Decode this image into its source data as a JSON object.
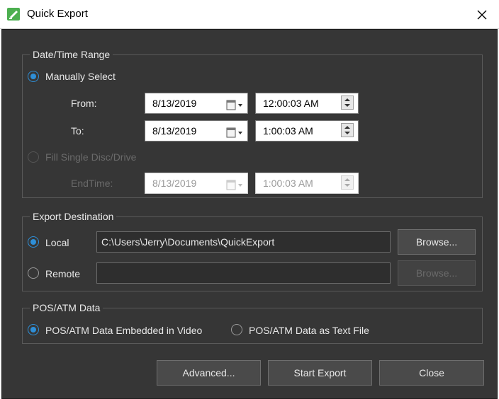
{
  "window": {
    "title": "Quick Export"
  },
  "date_range": {
    "group_title": "Date/Time Range",
    "manual_label": "Manually Select",
    "from_label": "From:",
    "from_date": "8/13/2019",
    "from_time": "12:00:03 AM",
    "to_label": "To:",
    "to_date": "8/13/2019",
    "to_time": "1:00:03 AM",
    "fill_label": "Fill Single Disc/Drive",
    "end_label": "EndTime:",
    "end_date": "8/13/2019",
    "end_time": "1:00:03 AM"
  },
  "export": {
    "group_title": "Export Destination",
    "local_label": "Local",
    "local_path": "C:\\Users\\Jerry\\Documents\\QuickExport",
    "browse_label": "Browse...",
    "remote_label": "Remote",
    "remote_path": "",
    "remote_browse_label": "Browse..."
  },
  "pos": {
    "group_title": "POS/ATM Data",
    "embedded_label": "POS/ATM Data Embedded in Video",
    "text_label": "POS/ATM Data as Text File"
  },
  "buttons": {
    "advanced": "Advanced...",
    "start": "Start Export",
    "close": "Close"
  },
  "colors": {
    "accent": "#2e8fd8",
    "background": "#363636",
    "app_icon": "#4caf50"
  }
}
